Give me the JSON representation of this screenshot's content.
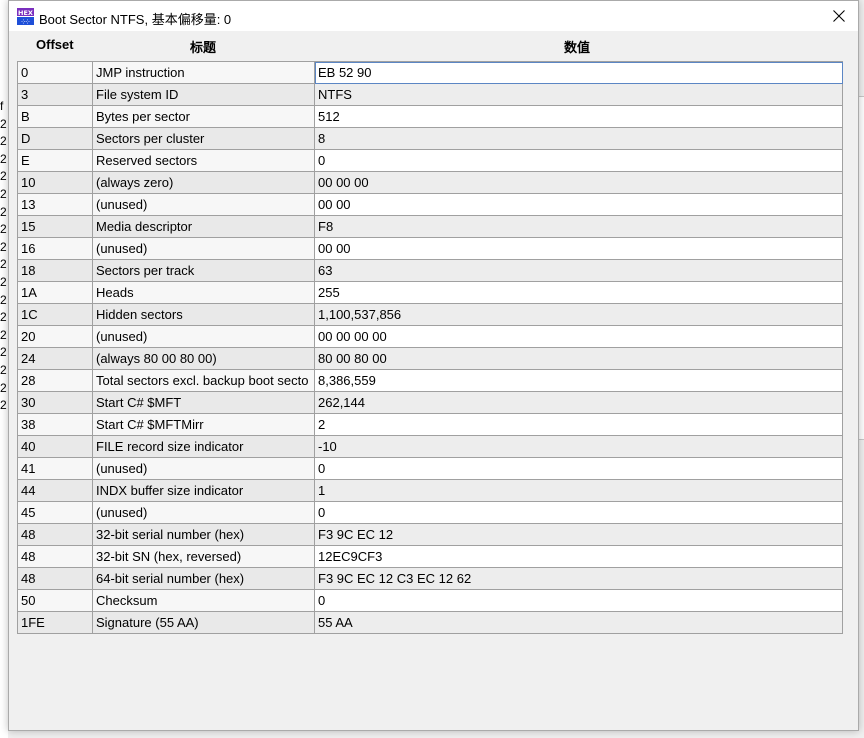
{
  "window": {
    "title": "Boot Sector NTFS, 基本偏移量: 0",
    "app_icon": "hex-app-icon",
    "close_icon": "close-icon"
  },
  "background_app": {
    "left_chars": [
      "f",
      "2",
      "2",
      "2",
      "2",
      "2",
      "2",
      "2",
      "2",
      "2",
      "2",
      "2",
      "2",
      "2",
      "2",
      "2",
      "2",
      "2"
    ]
  },
  "columns": {
    "offset": "Offset",
    "title": "标题",
    "value": "数值"
  },
  "rows": [
    {
      "offset": "0",
      "title": "JMP instruction",
      "value": "EB 52 90"
    },
    {
      "offset": "3",
      "title": "File system ID",
      "value": "NTFS"
    },
    {
      "offset": "B",
      "title": "Bytes per sector",
      "value": "512"
    },
    {
      "offset": "D",
      "title": "Sectors per cluster",
      "value": "8"
    },
    {
      "offset": "E",
      "title": "Reserved sectors",
      "value": "0"
    },
    {
      "offset": "10",
      "title": "(always zero)",
      "value": "00 00 00"
    },
    {
      "offset": "13",
      "title": "(unused)",
      "value": "00 00"
    },
    {
      "offset": "15",
      "title": "Media descriptor",
      "value": "F8"
    },
    {
      "offset": "16",
      "title": "(unused)",
      "value": "00 00"
    },
    {
      "offset": "18",
      "title": "Sectors per track",
      "value": "63"
    },
    {
      "offset": "1A",
      "title": "Heads",
      "value": "255"
    },
    {
      "offset": "1C",
      "title": "Hidden sectors",
      "value": "1,100,537,856"
    },
    {
      "offset": "20",
      "title": "(unused)",
      "value": "00 00 00 00"
    },
    {
      "offset": "24",
      "title": "(always 80 00 80 00)",
      "value": "80 00 80 00"
    },
    {
      "offset": "28",
      "title": "Total sectors excl. backup boot secto",
      "value": "8,386,559"
    },
    {
      "offset": "30",
      "title": "Start C# $MFT",
      "value": "262,144"
    },
    {
      "offset": "38",
      "title": "Start C# $MFTMirr",
      "value": "2"
    },
    {
      "offset": "40",
      "title": "FILE record size indicator",
      "value": "-10"
    },
    {
      "offset": "41",
      "title": "(unused)",
      "value": "0"
    },
    {
      "offset": "44",
      "title": "INDX buffer size indicator",
      "value": "1"
    },
    {
      "offset": "45",
      "title": "(unused)",
      "value": "0"
    },
    {
      "offset": "48",
      "title": "32-bit serial number (hex)",
      "value": "F3 9C EC 12"
    },
    {
      "offset": "48",
      "title": "32-bit SN (hex, reversed)",
      "value": "12EC9CF3"
    },
    {
      "offset": "48",
      "title": "64-bit serial number (hex)",
      "value": "F3 9C EC 12 C3 EC 12 62"
    },
    {
      "offset": "50",
      "title": "Checksum",
      "value": "0"
    },
    {
      "offset": "1FE",
      "title": "Signature (55 AA)",
      "value": "55 AA"
    }
  ],
  "colors": {
    "grid_line": "#a0a0a0",
    "selection_outline": "#5b86c4",
    "icon_purple": "#7b2fbe",
    "icon_blue": "#1e4fd8"
  }
}
